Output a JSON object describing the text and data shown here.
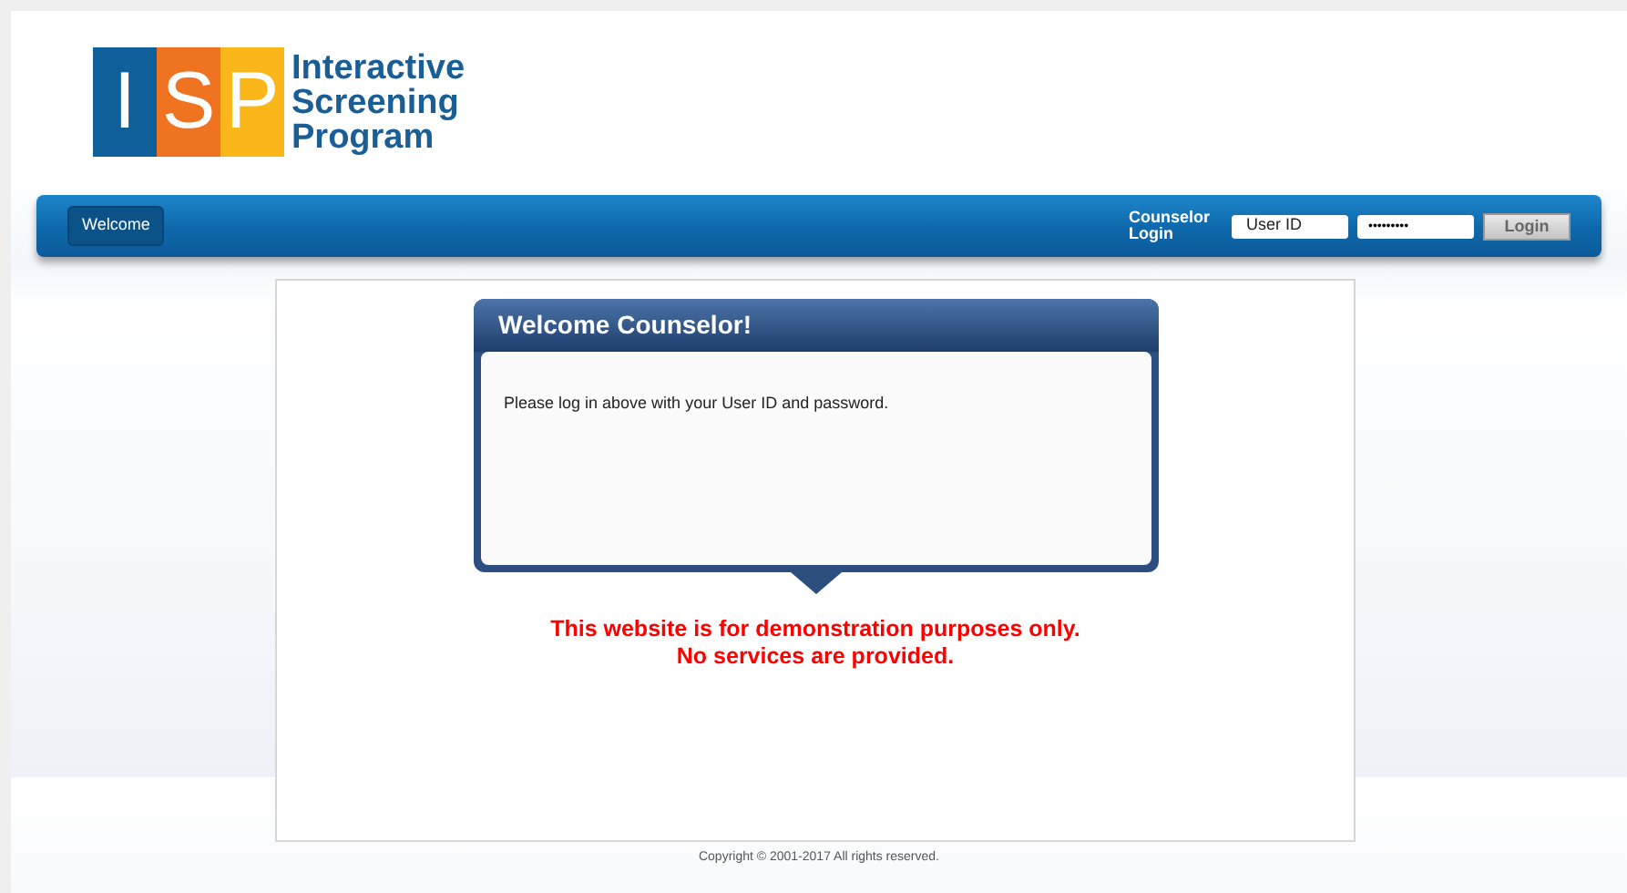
{
  "logo": {
    "letters": [
      "I",
      "S",
      "P"
    ],
    "name_lines": [
      "Interactive",
      "Screening",
      "Program"
    ]
  },
  "nav": {
    "tabs": [
      {
        "label": "Welcome",
        "selected": true
      }
    ],
    "login_label": [
      "Counselor",
      "Login"
    ],
    "user_field": {
      "placeholder": "User ID"
    },
    "password_field": {
      "value": "•••••••••"
    },
    "login_button": "Login"
  },
  "dialog": {
    "title": "Welcome Counselor!",
    "message": "Please log in above with your User ID and password."
  },
  "notice": [
    "This website is for demonstration purposes only.",
    "No services are provided."
  ],
  "footer": "Copyright © 2001-2017 All rights reserved."
}
